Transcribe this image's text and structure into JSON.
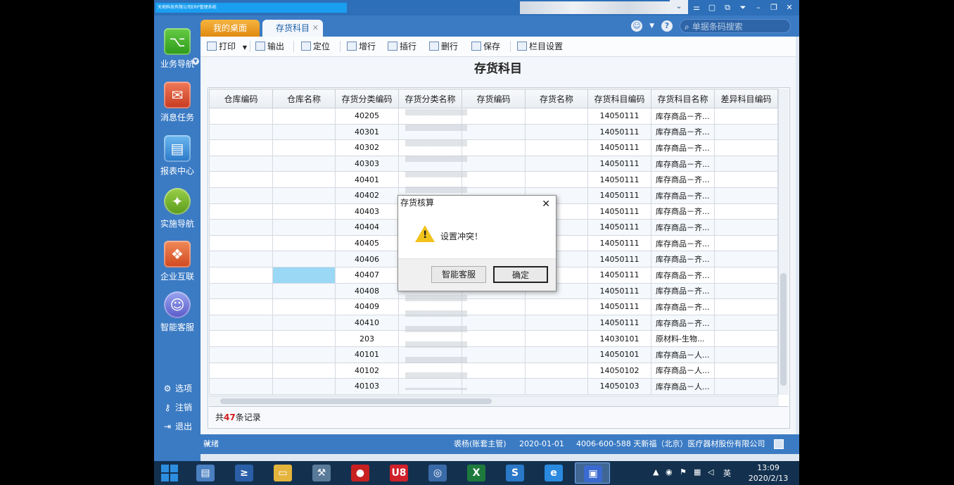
{
  "window": {
    "title": "天地科技有限公司ERP管理系统",
    "controls": [
      "⌄",
      "⚌",
      "▢",
      "⧉",
      "⏷",
      "–",
      "❐",
      "✕"
    ]
  },
  "sidebar": {
    "items": [
      {
        "label": "业务导航",
        "icon": "business-nav-icon"
      },
      {
        "label": "消息任务",
        "icon": "message-task-icon"
      },
      {
        "label": "报表中心",
        "icon": "report-center-icon"
      },
      {
        "label": "实施导航",
        "icon": "implement-nav-icon"
      },
      {
        "label": "企业互联",
        "icon": "enterprise-link-icon"
      },
      {
        "label": "智能客服",
        "icon": "smart-service-icon"
      }
    ],
    "bottom": [
      {
        "label": "选项",
        "icon": "gear-icon"
      },
      {
        "label": "注销",
        "icon": "key-icon"
      },
      {
        "label": "退出",
        "icon": "exit-icon"
      }
    ]
  },
  "tabs": [
    {
      "label": "我的桌面"
    },
    {
      "label": "存货科目"
    }
  ],
  "search": {
    "placeholder": "单据条码搜索"
  },
  "toolbar": {
    "print": "打印",
    "export": "输出",
    "locate": "定位",
    "add_row": "增行",
    "insert_row": "插行",
    "delete_row": "删行",
    "save": "保存",
    "column_settings": "栏目设置"
  },
  "page_title": "存货科目",
  "table": {
    "headers": [
      "仓库编码",
      "仓库名称",
      "存货分类编码",
      "存货分类名称",
      "存货编码",
      "存货名称",
      "存货科目编码",
      "存货科目名称",
      "差异科目编码"
    ],
    "rows": [
      [
        "",
        "",
        "40205",
        "",
        "",
        "",
        "14050111",
        "库存商品－齐...",
        ""
      ],
      [
        "",
        "",
        "40301",
        "",
        "",
        "",
        "14050111",
        "库存商品－齐...",
        ""
      ],
      [
        "",
        "",
        "40302",
        "",
        "",
        "",
        "14050111",
        "库存商品－齐...",
        ""
      ],
      [
        "",
        "",
        "40303",
        "",
        "",
        "",
        "14050111",
        "库存商品－齐...",
        ""
      ],
      [
        "",
        "",
        "40401",
        "",
        "",
        "",
        "14050111",
        "库存商品－齐...",
        ""
      ],
      [
        "",
        "",
        "40402",
        "",
        "",
        "",
        "14050111",
        "库存商品－齐...",
        ""
      ],
      [
        "",
        "",
        "40403",
        "",
        "",
        "",
        "14050111",
        "库存商品－齐...",
        ""
      ],
      [
        "",
        "",
        "40404",
        "",
        "",
        "",
        "14050111",
        "库存商品－齐...",
        ""
      ],
      [
        "",
        "",
        "40405",
        "",
        "",
        "",
        "14050111",
        "库存商品－齐...",
        ""
      ],
      [
        "",
        "",
        "40406",
        "",
        "",
        "",
        "14050111",
        "库存商品－齐...",
        ""
      ],
      [
        "",
        "",
        "40407",
        "",
        "",
        "",
        "14050111",
        "库存商品－齐...",
        ""
      ],
      [
        "",
        "",
        "40408",
        "",
        "",
        "",
        "14050111",
        "库存商品－齐...",
        ""
      ],
      [
        "",
        "",
        "40409",
        "",
        "",
        "",
        "14050111",
        "库存商品－齐...",
        ""
      ],
      [
        "",
        "",
        "40410",
        "",
        "",
        "",
        "14050111",
        "库存商品－齐...",
        ""
      ],
      [
        "",
        "",
        "203",
        "",
        "",
        "",
        "14030101",
        "原材料-生物...",
        ""
      ],
      [
        "",
        "",
        "40101",
        "",
        "",
        "",
        "14050101",
        "库存商品－人...",
        ""
      ],
      [
        "",
        "",
        "40102",
        "",
        "",
        "",
        "14050102",
        "库存商品－人...",
        ""
      ],
      [
        "",
        "",
        "40103",
        "",
        "",
        "",
        "14050103",
        "库存商品－人...",
        ""
      ]
    ],
    "selected_row": 10,
    "footer_prefix": "共",
    "record_count": "47",
    "footer_suffix": "条记录"
  },
  "status": {
    "ready": "就绪",
    "user": "裘杨(账套主管)",
    "date": "2020-01-01",
    "company": "4006-600-588 天新福（北京）医疗器材股份有限公司"
  },
  "dialog": {
    "title": "存货核算",
    "message": "设置冲突！",
    "btn_service": "智能客服",
    "btn_ok": "确定"
  },
  "taskbar": {
    "apps": [
      {
        "icon": "server-manager-icon",
        "glyph": "▤",
        "color": "#4a7fc0"
      },
      {
        "icon": "powershell-icon",
        "glyph": "≥",
        "color": "#2a5fa8"
      },
      {
        "icon": "file-explorer-icon",
        "glyph": "▭",
        "color": "#e4b43c"
      },
      {
        "icon": "tools-icon",
        "glyph": "⚒",
        "color": "#5a7a9a"
      },
      {
        "icon": "red-app-icon",
        "glyph": "●",
        "color": "#c82020"
      },
      {
        "icon": "u8-icon",
        "glyph": "U8",
        "color": "#d0202a"
      },
      {
        "icon": "compass-app-icon",
        "glyph": "◎",
        "color": "#3a6aa8"
      },
      {
        "icon": "excel-icon",
        "glyph": "X",
        "color": "#1e7a3c"
      },
      {
        "icon": "app-s-icon",
        "glyph": "S",
        "color": "#2a78c8"
      },
      {
        "icon": "ie-icon",
        "glyph": "e",
        "color": "#2a8ae0"
      },
      {
        "icon": "remote-app-icon",
        "glyph": "▣",
        "color": "#3a6ad0"
      }
    ],
    "tray_lang": "英",
    "time": "13:09",
    "date": "2020/2/13"
  }
}
